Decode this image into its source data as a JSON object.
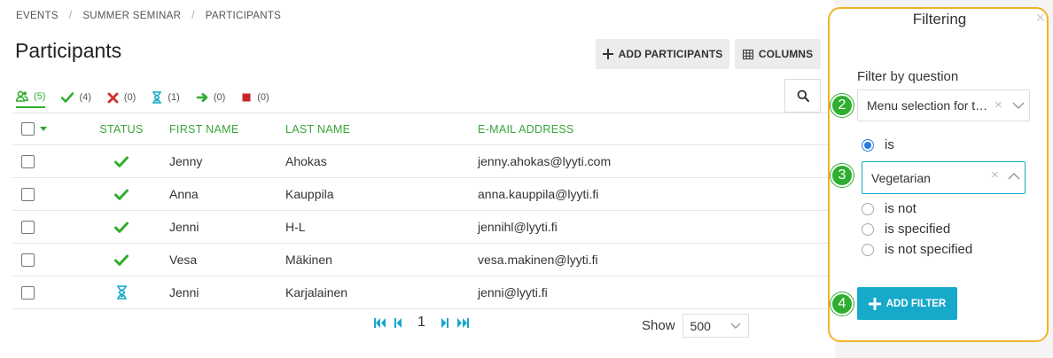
{
  "breadcrumb": [
    "EVENTS",
    "SUMMER SEMINAR",
    "PARTICIPANTS"
  ],
  "page_title": "Participants",
  "toolbar": {
    "add_label": "ADD PARTICIPANTS",
    "columns_label": "COLUMNS"
  },
  "status_tabs": [
    {
      "icon": "group-icon",
      "count": "(5)",
      "color": "#2fae2f"
    },
    {
      "icon": "check-icon",
      "count": "(4)",
      "color": "#2fae2f"
    },
    {
      "icon": "cross-icon",
      "count": "(0)",
      "color": "#d32f2f"
    },
    {
      "icon": "hourglass-icon",
      "count": "(1)",
      "color": "#17a9c9"
    },
    {
      "icon": "arrow-right-icon",
      "count": "(0)",
      "color": "#2fae2f"
    },
    {
      "icon": "stop-icon",
      "count": "(0)",
      "color": "#c62828"
    }
  ],
  "table": {
    "headers": {
      "status": "STATUS",
      "first": "FIRST NAME",
      "last": "LAST NAME",
      "email": "E-MAIL ADDRESS"
    },
    "rows": [
      {
        "status": "check-icon",
        "first": "Jenny",
        "last": "Ahokas",
        "email": "jenny.ahokas@lyyti.com"
      },
      {
        "status": "check-icon",
        "first": "Anna",
        "last": "Kauppila",
        "email": "anna.kauppila@lyyti.fi"
      },
      {
        "status": "check-icon",
        "first": "Jenni",
        "last": "H-L",
        "email": "jennihl@lyyti.fi"
      },
      {
        "status": "check-icon",
        "first": "Vesa",
        "last": "Mäkinen",
        "email": "vesa.makinen@lyyti.fi"
      },
      {
        "status": "hourglass-icon",
        "first": "Jenni",
        "last": "Karjalainen",
        "email": "jenni@lyyti.fi"
      }
    ]
  },
  "pager": {
    "page": "1",
    "show_label": "Show",
    "show_value": "500"
  },
  "filter_panel": {
    "title": "Filtering",
    "close": "×",
    "filter_by_label": "Filter by question",
    "question_value": "Menu selection for the event",
    "steps": [
      "2",
      "3",
      "4"
    ],
    "options": {
      "is": "is",
      "is_not": "is not",
      "is_specified": "is specified",
      "is_not_specified": "is not specified"
    },
    "selected_option": "is",
    "value_selected": "Vegetarian",
    "add_filter_label": "ADD FILTER"
  },
  "colors": {
    "green": "#2fae2f",
    "teal": "#17a9c9",
    "panel_border": "#f0b429",
    "radio_blue": "#2a7ae2"
  }
}
